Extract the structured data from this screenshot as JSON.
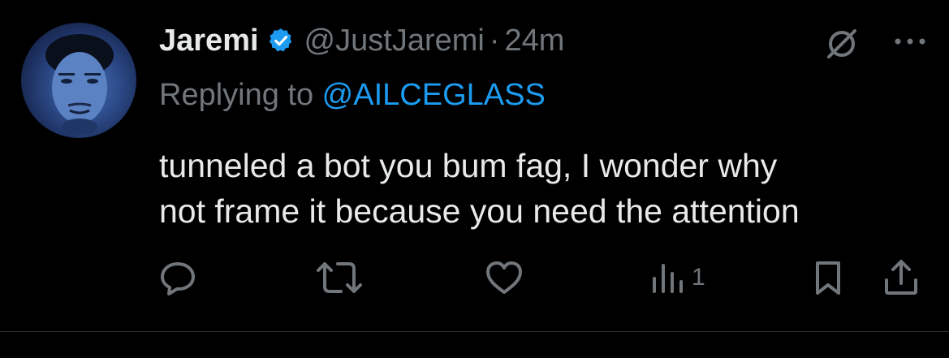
{
  "author": {
    "name": "Jaremi",
    "handle": "@JustJaremi",
    "separator": "·",
    "time": "24m"
  },
  "reply": {
    "prefix": "Replying to ",
    "mention": "@AILCEGLASS"
  },
  "text_lines": [
    "tunneled a bot you bum fag, I wonder why",
    "not frame it because you need the attention"
  ],
  "actions": {
    "reply_icon": "speech-bubble-icon",
    "retweet_icon": "retweet-icon",
    "like_icon": "heart-icon",
    "views_icon": "bar-chart-icon",
    "views_count": "1",
    "bookmark_icon": "bookmark-icon",
    "share_icon": "share-upload-icon"
  },
  "colors": {
    "background": "#000000",
    "text": "#e7e9ea",
    "secondary": "#71767b",
    "link": "#1d9bf0",
    "verified": "#1d9bf0"
  }
}
